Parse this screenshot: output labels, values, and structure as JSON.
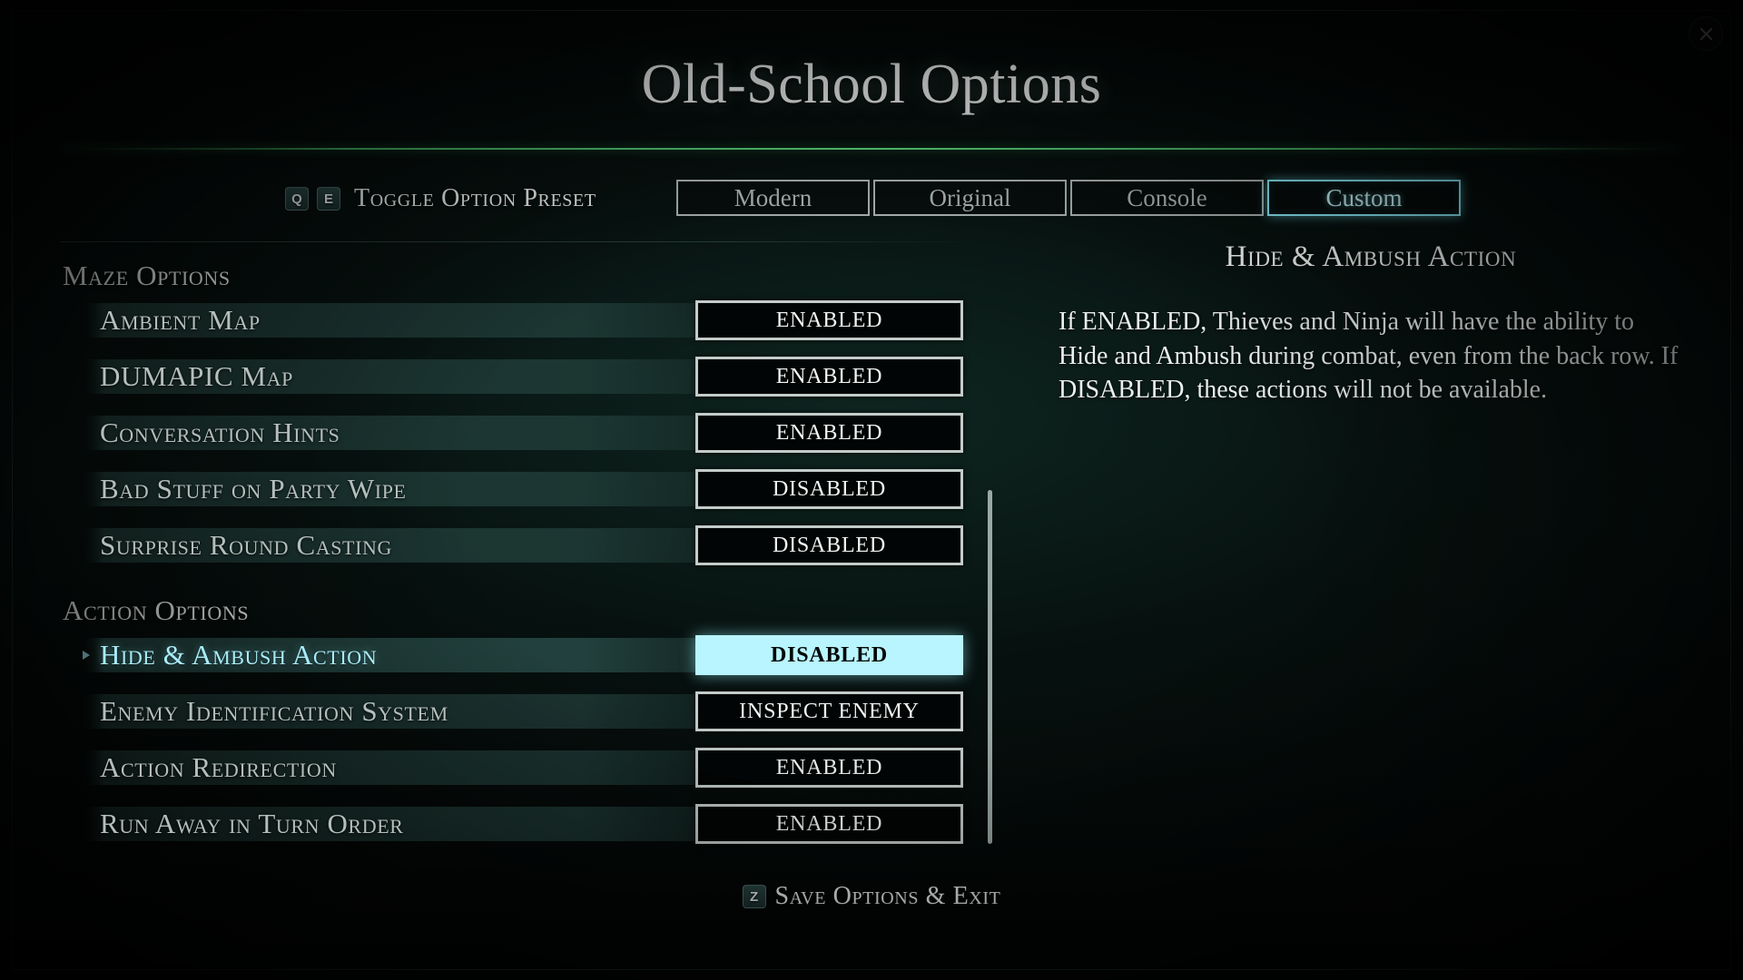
{
  "window": {
    "title": "Old-School Options",
    "close_icon": "close-icon"
  },
  "preset": {
    "key_left": "Q",
    "key_right": "E",
    "hint_label": "Toggle Option Preset",
    "options": [
      {
        "label": "Modern",
        "selected": false
      },
      {
        "label": "Original",
        "selected": false
      },
      {
        "label": "Console",
        "selected": false
      },
      {
        "label": "Custom",
        "selected": true
      }
    ]
  },
  "sections": [
    {
      "heading": "Maze Options",
      "rows": [
        {
          "label": "Ambient Map",
          "value": "ENABLED",
          "selected": false
        },
        {
          "label": "DUMAPIC Map",
          "value": "ENABLED",
          "selected": false
        },
        {
          "label": "Conversation Hints",
          "value": "ENABLED",
          "selected": false
        },
        {
          "label": "Bad Stuff on Party Wipe",
          "value": "DISABLED",
          "selected": false
        },
        {
          "label": "Surprise Round Casting",
          "value": "DISABLED",
          "selected": false
        }
      ]
    },
    {
      "heading": "Action Options",
      "rows": [
        {
          "label": "Hide & Ambush Action",
          "value": "DISABLED",
          "selected": true
        },
        {
          "label": "Enemy Identification System",
          "value": "INSPECT ENEMY",
          "selected": false
        },
        {
          "label": "Action Redirection",
          "value": "ENABLED",
          "selected": false
        },
        {
          "label": "Run Away in Turn Order",
          "value": "ENABLED",
          "selected": false
        }
      ]
    }
  ],
  "description": {
    "title": "Hide & Ambush Action",
    "body": "If ENABLED, Thieves and Ninja will have the ability to Hide and Ambush during combat, even from the back row. If DISABLED, these actions will not be available."
  },
  "footer": {
    "key": "Z",
    "label": "Save Options & Exit"
  },
  "colors": {
    "accent_cyan": "#b8f5fe",
    "divider_green": "#5ac878",
    "row_bar": "#24423e",
    "text_primary": "#f2f6f4",
    "text_muted": "#b4bfbc"
  }
}
